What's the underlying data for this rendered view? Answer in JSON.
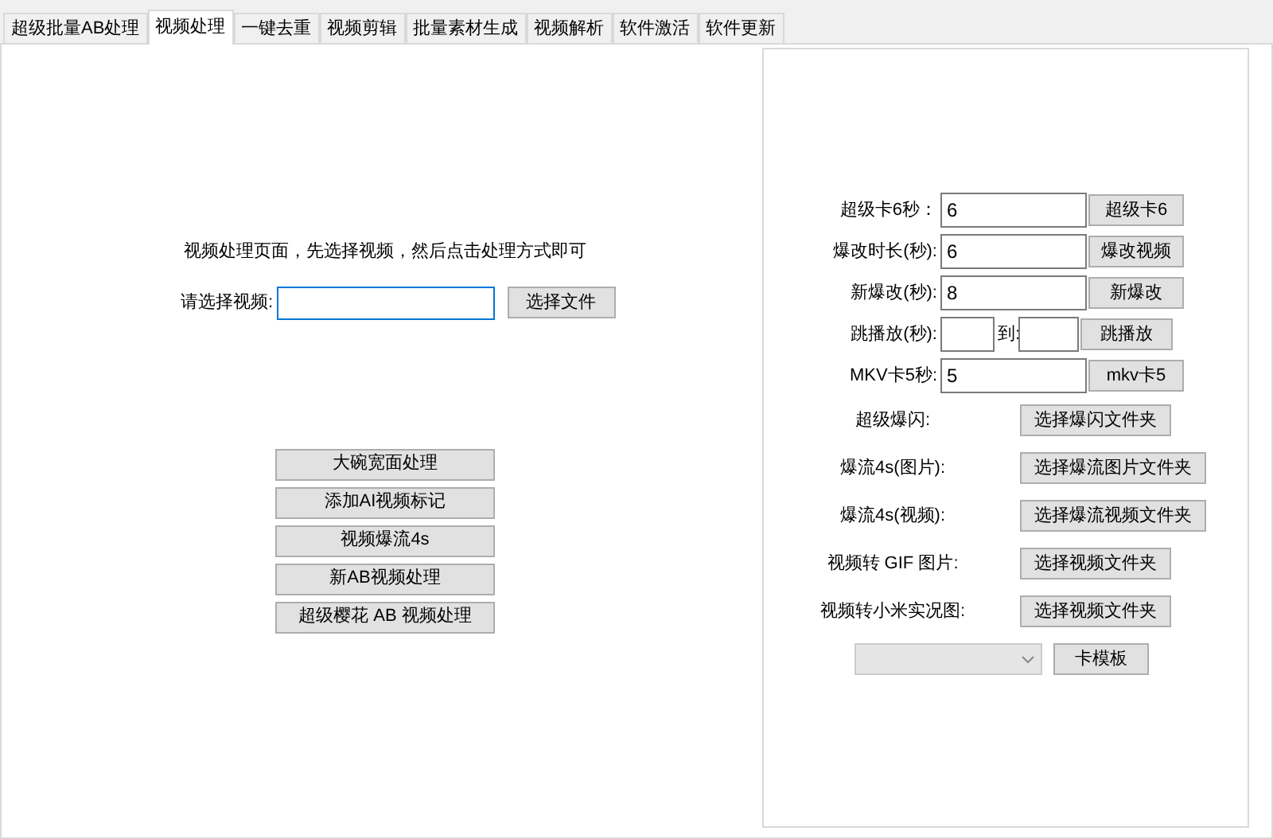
{
  "tabs": [
    {
      "label": "超级批量AB处理",
      "selected": false
    },
    {
      "label": "视频处理",
      "selected": true
    },
    {
      "label": "一键去重",
      "selected": false
    },
    {
      "label": "视频剪辑",
      "selected": false
    },
    {
      "label": "批量素材生成",
      "selected": false
    },
    {
      "label": "视频解析",
      "selected": false
    },
    {
      "label": "软件激活",
      "selected": false
    },
    {
      "label": "软件更新",
      "selected": false
    }
  ],
  "left": {
    "prompt": "视频处理页面，先选择视频，然后点击处理方式即可",
    "file_label": "请选择视频:",
    "file_button": "选择文件",
    "actions": [
      "大碗宽面处理",
      "添加AI视频标记",
      "视频爆流4s",
      "新AB视频处理",
      "超级樱花 AB 视频处理"
    ]
  },
  "right": {
    "rows": [
      {
        "kind": "field",
        "label": "超级卡6秒：",
        "value": "6",
        "button": "超级卡6"
      },
      {
        "kind": "field",
        "label": "爆改时长(秒):",
        "value": "6",
        "button": "爆改视频"
      },
      {
        "kind": "field",
        "label": "新爆改(秒):",
        "value": "8",
        "button": "新爆改"
      },
      {
        "kind": "range",
        "label": "跳播放(秒):",
        "to_label": "到:",
        "button": "跳播放"
      },
      {
        "kind": "field",
        "label": "MKV卡5秒:",
        "value": "5",
        "button": "mkv卡5"
      },
      {
        "kind": "folder",
        "label": "超级爆闪:",
        "button": "选择爆闪文件夹"
      },
      {
        "kind": "folder",
        "label": "爆流4s(图片):",
        "button": "选择爆流图片文件夹"
      },
      {
        "kind": "folder",
        "label": "爆流4s(视频):",
        "button": "选择爆流视频文件夹"
      },
      {
        "kind": "folder",
        "label": "视频转 GIF 图片:",
        "button": "选择视频文件夹"
      },
      {
        "kind": "folder",
        "label": "视频转小米实况图:",
        "button": "选择视频文件夹"
      },
      {
        "kind": "combo",
        "button": "卡模板"
      }
    ]
  }
}
